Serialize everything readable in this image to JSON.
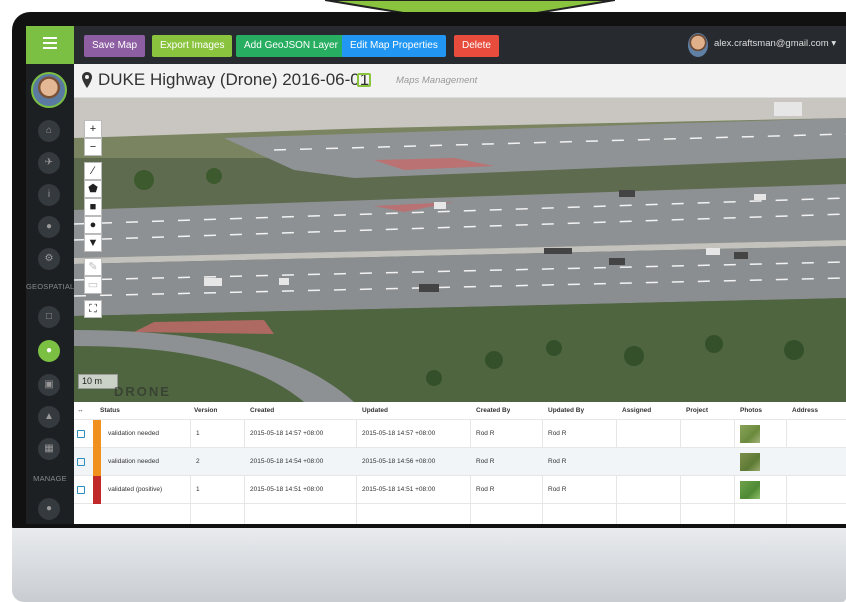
{
  "toolbar": {
    "save_label": "Save Map",
    "export_label": "Export Images",
    "geojson_label": "Add GeoJSON Layer",
    "edit_label": "Edit Map Properties",
    "delete_label": "Delete",
    "user_email": "alex.craftsman@gmail.com ▾"
  },
  "sidebar": {
    "section_geospatial": "GEOSPATIAL",
    "section_manage": "MANAGE"
  },
  "header": {
    "title": "DUKE Highway (Drone) 2016-06-01",
    "subtitle": "Maps Management"
  },
  "map": {
    "zoom_in": "+",
    "zoom_out": "−",
    "scale": "10 m",
    "watermark": "DRONE"
  },
  "table": {
    "headers": {
      "expand": "↔",
      "status": "Status",
      "version": "Version",
      "created": "Created",
      "updated": "Updated",
      "created_by": "Created By",
      "updated_by": "Updated By",
      "assigned": "Assigned",
      "project": "Project",
      "photos": "Photos",
      "address": "Address"
    },
    "rows": [
      {
        "status": "validation needed",
        "version": "1",
        "created": "2015-05-18 14:57 +08:00",
        "updated": "2015-05-18 14:57 +08:00",
        "created_by": "Rod R",
        "updated_by": "Rod R"
      },
      {
        "status": "validation needed",
        "version": "2",
        "created": "2015-05-18 14:54 +08:00",
        "updated": "2015-05-18 14:56 +08:00",
        "created_by": "Rod R",
        "updated_by": "Rod R"
      },
      {
        "status": "validated (positive)",
        "version": "1",
        "created": "2015-05-18 14:51 +08:00",
        "updated": "2015-05-18 14:51 +08:00",
        "created_by": "Rod R",
        "updated_by": "Rod R"
      }
    ]
  },
  "colors": {
    "accent": "#7bc043",
    "status_needed": "#f0901e",
    "status_validated": "#c0282a"
  }
}
